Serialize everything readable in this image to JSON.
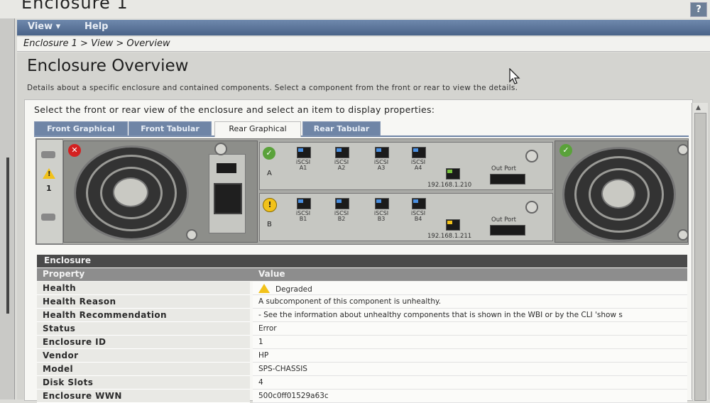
{
  "header": {
    "title": "Enclosure 1",
    "help_icon": "?"
  },
  "menu": {
    "items": [
      "View ▾",
      "Help"
    ]
  },
  "breadcrumb": "Enclosure 1 > View > Overview",
  "page": {
    "title": "Enclosure Overview",
    "description": "Details about a specific enclosure and contained components. Select a component from the front or rear to view the details.",
    "instruction": "Select the front or rear view of the enclosure and select an item to display properties:"
  },
  "tabs": [
    {
      "label": "Front Graphical",
      "active": false
    },
    {
      "label": "Front Tabular",
      "active": false
    },
    {
      "label": "Rear Graphical",
      "active": true
    },
    {
      "label": "Rear Tabular",
      "active": false
    }
  ],
  "enclosure_graphic": {
    "enclosure_number": "1",
    "controllers": [
      {
        "letter": "A",
        "ports": [
          "iSCSI\nA1",
          "iSCSI\nA2",
          "iSCSI\nA3",
          "iSCSI\nA4"
        ],
        "ip": "192.168.1.210",
        "out_port": "Out Port",
        "status": "ok"
      },
      {
        "letter": "B",
        "ports": [
          "iSCSI\nB1",
          "iSCSI\nB2",
          "iSCSI\nB3",
          "iSCSI\nB4"
        ],
        "ip": "192.168.1.211",
        "out_port": "Out Port",
        "status": "warning"
      }
    ],
    "left_psu_status": "error",
    "right_psu_status": "ok",
    "status_colors": {
      "ok": "#5aa23a",
      "error": "#d42020",
      "warning": "#f2c21a"
    }
  },
  "properties": {
    "section_title": "Enclosure",
    "columns": [
      "Property",
      "Value"
    ],
    "rows": [
      {
        "property": "Health",
        "value": "Degraded",
        "icon": "warning-icon"
      },
      {
        "property": "Health Reason",
        "value": "A subcomponent of this component is unhealthy."
      },
      {
        "property": "Health Recommendation",
        "value": "- See the information about unhealthy components that is shown in the WBI or by the CLI 'show s"
      },
      {
        "property": "Status",
        "value": "Error"
      },
      {
        "property": "Enclosure ID",
        "value": "1"
      },
      {
        "property": "Vendor",
        "value": "HP"
      },
      {
        "property": "Model",
        "value": "SPS-CHASSIS"
      },
      {
        "property": "Disk Slots",
        "value": "4"
      },
      {
        "property": "Enclosure WWN",
        "value": "500c0ff01529a63c"
      }
    ]
  },
  "colors": {
    "menubar": "#5a7396",
    "tab": "#6f85a6",
    "section_header": "#4a4a4a"
  }
}
